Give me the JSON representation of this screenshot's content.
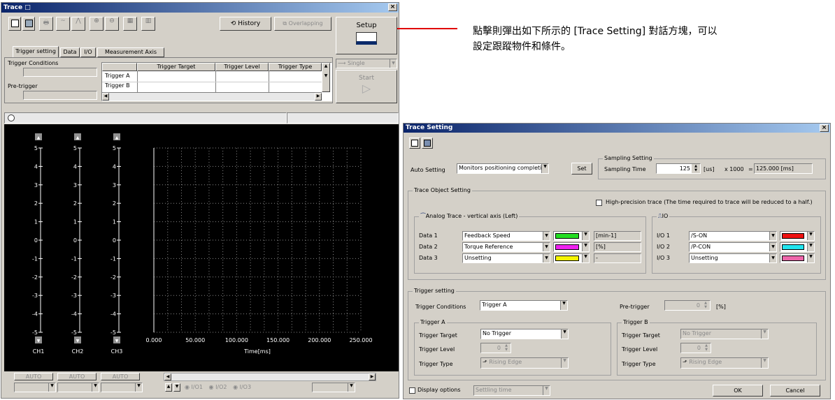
{
  "trace_window": {
    "title": "Trace □",
    "toolbar": {
      "history_label": "History",
      "overlapping_label": "Overlapping",
      "setup_label": "Setup",
      "mode_label": "Single",
      "start_label": "Start"
    },
    "tabs": [
      "Trigger setting",
      "Data",
      "I/O",
      "Measurement Axis"
    ],
    "trigger_conditions_label": "Trigger Conditions",
    "pre_trigger_label": "Pre-trigger",
    "trigger_table": {
      "headers": [
        "Trigger Target",
        "Trigger Level",
        "Trigger Type"
      ],
      "rows": [
        "Trigger A",
        "Trigger B"
      ]
    },
    "plot": {
      "y_ticks": [
        "5",
        "4",
        "3",
        "2",
        "1",
        "0",
        "-1",
        "-2",
        "-3",
        "-4",
        "-5"
      ],
      "channels": [
        "CH1",
        "CH2",
        "CH3"
      ],
      "x_ticks": [
        "0.000",
        "50.000",
        "100.000",
        "150.000",
        "200.000",
        "250.000"
      ],
      "x_label": "Time[ms]"
    },
    "auto_buttons": [
      "AUTO",
      "AUTO",
      "AUTO"
    ],
    "io_radios": [
      "I/O1",
      "I/O2",
      "I/O3"
    ]
  },
  "annotation": {
    "line1": "點擊則彈出如下所示的 [Trace Setting] 對話方塊，可以",
    "line2": "設定跟蹤物件和條件。"
  },
  "dialog": {
    "title": "Trace Setting",
    "auto_setting_label": "Auto Setting",
    "auto_setting_value": "Monitors positioning completion (",
    "set_label": "Set",
    "sampling_group": "Sampling Setting",
    "sampling_time_label": "Sampling Time",
    "sampling_time_value": "125",
    "sampling_unit": "[us]",
    "sampling_mult": "x 1000",
    "sampling_eq": "=",
    "sampling_result": "125.000 [ms]",
    "trace_object_group": "Trace Object Setting",
    "high_precision_label": "High-precision trace (The time required to trace will be reduced to a half.)",
    "analog_group": "Analog Trace - vertical axis (Left)",
    "analog_rows": [
      {
        "label": "Data 1",
        "value": "Feedback Speed",
        "unit": "[min-1]",
        "color": "#22dd22"
      },
      {
        "label": "Data 2",
        "value": "Torque Reference",
        "unit": "[%]",
        "color": "#ee22ee"
      },
      {
        "label": "Data 3",
        "value": "Unsetting",
        "unit": "-",
        "color": "#f5f500"
      }
    ],
    "io_group": "IO",
    "io_rows": [
      {
        "label": "I/O 1",
        "value": "/S-ON",
        "color": "#ee1111"
      },
      {
        "label": "I/O 2",
        "value": "/P-CON",
        "color": "#22e5ee"
      },
      {
        "label": "I/O 3",
        "value": "Unsetting",
        "color": "#ee66aa"
      }
    ],
    "trigger_group": "Trigger setting",
    "trigger_conditions_label": "Trigger Conditions",
    "trigger_conditions_value": "Trigger A",
    "pre_trigger_label": "Pre-trigger",
    "pre_trigger_value": "0",
    "pre_trigger_unit": "[%]",
    "trigger_a": {
      "group": "Trigger A",
      "target_label": "Trigger Target",
      "target_value": "No Trigger",
      "level_label": "Trigger Level",
      "level_value": "0",
      "type_label": "Trigger Type",
      "type_value": "Rising Edge"
    },
    "trigger_b": {
      "group": "Trigger B",
      "target_label": "Trigger Target",
      "target_value": "No Trigger",
      "level_label": "Trigger Level",
      "level_value": "0",
      "type_label": "Trigger Type",
      "type_value": "Rising Edge"
    },
    "display_options_label": "Display options",
    "display_options_value": "Settling time",
    "ok_label": "OK",
    "cancel_label": "Cancel"
  }
}
